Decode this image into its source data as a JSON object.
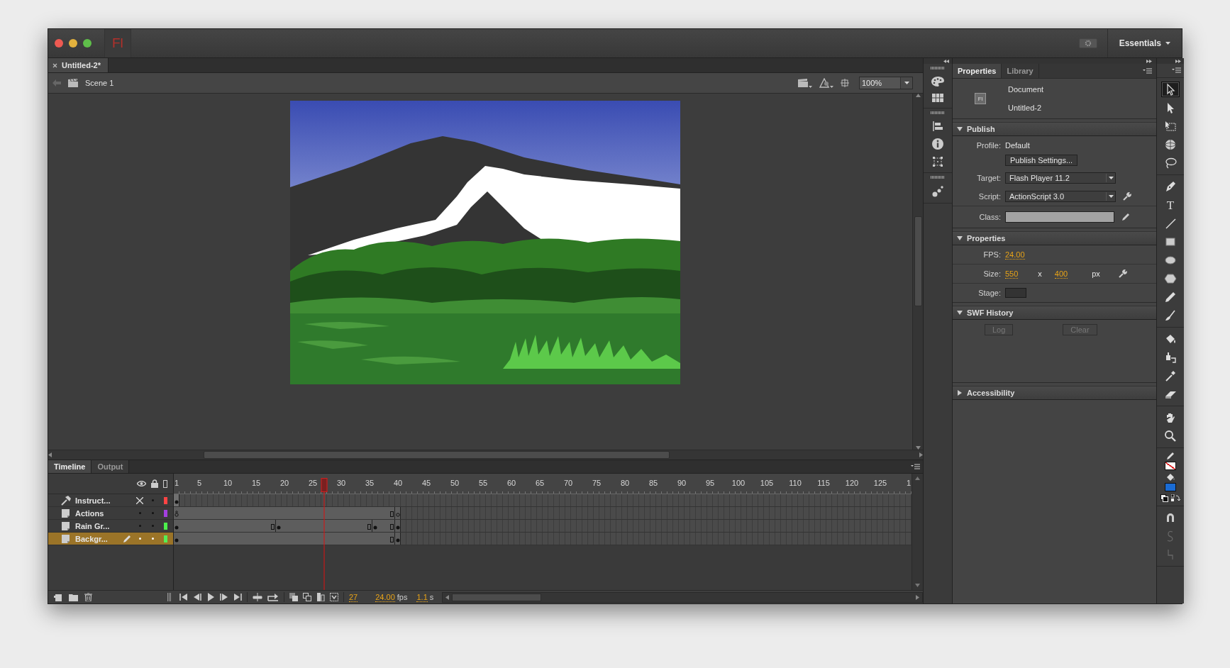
{
  "window": {
    "app_logo": "Fl",
    "workspace": "Essentials"
  },
  "document_tabs": [
    {
      "label": "Untitled-2*",
      "selected": true
    }
  ],
  "scene_bar": {
    "scene": "Scene 1",
    "zoom": "100%"
  },
  "properties_panel": {
    "tabs": [
      {
        "label": "Properties",
        "selected": true
      },
      {
        "label": "Library",
        "selected": false
      }
    ],
    "document": {
      "icon_text": "Fl",
      "type": "Document",
      "name": "Untitled-2"
    },
    "sections": [
      {
        "kind": "publish",
        "title": "Publish",
        "expanded": true,
        "profile_label": "Profile:",
        "profile_value": "Default",
        "settings_button": "Publish Settings...",
        "target_label": "Target:",
        "target_value": "Flash Player 11.2",
        "script_label": "Script:",
        "script_value": "ActionScript 3.0",
        "class_label": "Class:"
      },
      {
        "kind": "properties",
        "title": "Properties",
        "expanded": true,
        "fps_label": "FPS:",
        "fps_value": "24.00",
        "size_label": "Size:",
        "width_value": "550",
        "times": "x",
        "height_value": "400",
        "unit": "px",
        "stage_label": "Stage:"
      },
      {
        "kind": "swf_history",
        "title": "SWF History",
        "expanded": true,
        "buttons": [
          {
            "label": "Log",
            "disabled": true
          },
          {
            "label": "Clear",
            "disabled": true
          }
        ]
      },
      {
        "kind": "accessibility",
        "title": "Accessibility",
        "expanded": false
      }
    ]
  },
  "tools": {
    "groups": [
      [
        {
          "kind": "selection",
          "selected": true
        },
        {
          "kind": "subselection",
          "selected": false
        },
        {
          "kind": "free_transform",
          "selected": false
        },
        {
          "kind": "rotation_3d",
          "selected": false
        },
        {
          "kind": "lasso",
          "selected": false
        }
      ],
      [
        {
          "kind": "pen",
          "selected": false
        },
        {
          "kind": "text",
          "glyph": "T",
          "selected": false
        },
        {
          "kind": "line",
          "selected": false
        },
        {
          "kind": "rectangle",
          "selected": false
        },
        {
          "kind": "oval",
          "selected": false
        },
        {
          "kind": "polystar",
          "selected": false
        },
        {
          "kind": "pencil",
          "selected": false
        },
        {
          "kind": "brush",
          "selected": false
        }
      ],
      [
        {
          "kind": "paint_bucket",
          "selected": false
        },
        {
          "kind": "ink_bottle",
          "selected": false
        },
        {
          "kind": "eyedropper",
          "selected": false
        },
        {
          "kind": "eraser",
          "selected": false
        }
      ],
      [
        {
          "kind": "hand",
          "selected": false
        },
        {
          "kind": "zoom",
          "selected": false
        }
      ],
      [
        {
          "kind": "stroke_swatch",
          "color": "#ffffff",
          "none": true
        },
        {
          "kind": "fill_swatch",
          "color": "#1a6bd3",
          "none": false
        },
        {
          "kind": "color_buttons"
        }
      ],
      [
        {
          "kind": "snap",
          "selected": false
        },
        {
          "kind": "smooth",
          "selected": false
        },
        {
          "kind": "straighten",
          "selected": false
        }
      ]
    ]
  },
  "timeline": {
    "tabs": [
      {
        "label": "Timeline",
        "selected": true
      },
      {
        "label": "Output",
        "selected": false
      }
    ],
    "ruler": [
      "1",
      "5",
      "10",
      "15",
      "20",
      "25",
      "30",
      "35",
      "40",
      "45",
      "50",
      "55",
      "60",
      "65",
      "70",
      "75",
      "80",
      "85",
      "90",
      "95",
      "100",
      "105",
      "110",
      "115",
      "120",
      "125",
      "1"
    ],
    "playhead": {
      "level": 0.2038
    },
    "layers": [
      {
        "name": "Instruct...",
        "kind": "guide",
        "hidden": true,
        "locked": false,
        "selected": false,
        "color": "#ff4444",
        "frames": [
          {
            "kind": "keyframe"
          }
        ]
      },
      {
        "name": "Actions",
        "kind": "normal",
        "hidden": false,
        "locked": false,
        "selected": false,
        "color": "#a33fe0",
        "frames": [
          {
            "kind": "action_keyframe"
          },
          {
            "kind": "frame"
          },
          {
            "kind": "frame"
          },
          {
            "kind": "frame"
          },
          {
            "kind": "frame"
          },
          {
            "kind": "frame"
          },
          {
            "kind": "frame"
          },
          {
            "kind": "frame"
          },
          {
            "kind": "frame"
          },
          {
            "kind": "frame"
          },
          {
            "kind": "frame"
          },
          {
            "kind": "frame"
          },
          {
            "kind": "frame"
          },
          {
            "kind": "frame"
          },
          {
            "kind": "frame"
          },
          {
            "kind": "frame"
          },
          {
            "kind": "frame"
          },
          {
            "kind": "frame"
          },
          {
            "kind": "frame"
          },
          {
            "kind": "frame"
          },
          {
            "kind": "frame"
          },
          {
            "kind": "frame"
          },
          {
            "kind": "frame"
          },
          {
            "kind": "frame"
          },
          {
            "kind": "frame"
          },
          {
            "kind": "frame"
          },
          {
            "kind": "frame"
          },
          {
            "kind": "frame"
          },
          {
            "kind": "frame"
          },
          {
            "kind": "frame"
          },
          {
            "kind": "frame"
          },
          {
            "kind": "frame"
          },
          {
            "kind": "frame"
          },
          {
            "kind": "frame"
          },
          {
            "kind": "frame"
          },
          {
            "kind": "frame"
          },
          {
            "kind": "frame"
          },
          {
            "kind": "frame"
          },
          {
            "kind": "end_frame"
          },
          {
            "kind": "empty_keyframe"
          }
        ]
      },
      {
        "name": "Rain Gr...",
        "kind": "normal",
        "hidden": false,
        "locked": false,
        "selected": false,
        "color": "#4cf04c",
        "frames": [
          {
            "kind": "keyframe"
          },
          {
            "kind": "frame"
          },
          {
            "kind": "frame"
          },
          {
            "kind": "frame"
          },
          {
            "kind": "frame"
          },
          {
            "kind": "frame"
          },
          {
            "kind": "frame"
          },
          {
            "kind": "frame"
          },
          {
            "kind": "frame"
          },
          {
            "kind": "frame"
          },
          {
            "kind": "frame"
          },
          {
            "kind": "frame"
          },
          {
            "kind": "frame"
          },
          {
            "kind": "frame"
          },
          {
            "kind": "frame"
          },
          {
            "kind": "frame"
          },
          {
            "kind": "frame"
          },
          {
            "kind": "end_frame"
          },
          {
            "kind": "keyframe"
          },
          {
            "kind": "frame"
          },
          {
            "kind": "frame"
          },
          {
            "kind": "frame"
          },
          {
            "kind": "frame"
          },
          {
            "kind": "frame"
          },
          {
            "kind": "frame"
          },
          {
            "kind": "frame"
          },
          {
            "kind": "frame"
          },
          {
            "kind": "frame"
          },
          {
            "kind": "frame"
          },
          {
            "kind": "frame"
          },
          {
            "kind": "frame"
          },
          {
            "kind": "frame"
          },
          {
            "kind": "frame"
          },
          {
            "kind": "frame"
          },
          {
            "kind": "end_frame"
          },
          {
            "kind": "keyframe"
          },
          {
            "kind": "frame"
          },
          {
            "kind": "frame"
          },
          {
            "kind": "end_frame"
          },
          {
            "kind": "keyframe"
          }
        ]
      },
      {
        "name": "Backgr...",
        "kind": "normal",
        "hidden": false,
        "locked": false,
        "selected": true,
        "color": "#55ee55",
        "frames": [
          {
            "kind": "keyframe"
          },
          {
            "kind": "frame"
          },
          {
            "kind": "frame"
          },
          {
            "kind": "frame"
          },
          {
            "kind": "frame"
          },
          {
            "kind": "frame"
          },
          {
            "kind": "frame"
          },
          {
            "kind": "frame"
          },
          {
            "kind": "frame"
          },
          {
            "kind": "frame"
          },
          {
            "kind": "frame"
          },
          {
            "kind": "frame"
          },
          {
            "kind": "frame"
          },
          {
            "kind": "frame"
          },
          {
            "kind": "frame"
          },
          {
            "kind": "frame"
          },
          {
            "kind": "frame"
          },
          {
            "kind": "frame"
          },
          {
            "kind": "frame"
          },
          {
            "kind": "frame"
          },
          {
            "kind": "frame"
          },
          {
            "kind": "frame"
          },
          {
            "kind": "frame"
          },
          {
            "kind": "frame"
          },
          {
            "kind": "frame"
          },
          {
            "kind": "frame"
          },
          {
            "kind": "frame"
          },
          {
            "kind": "frame"
          },
          {
            "kind": "frame"
          },
          {
            "kind": "frame"
          },
          {
            "kind": "frame"
          },
          {
            "kind": "frame"
          },
          {
            "kind": "frame"
          },
          {
            "kind": "frame"
          },
          {
            "kind": "frame"
          },
          {
            "kind": "frame"
          },
          {
            "kind": "frame"
          },
          {
            "kind": "frame"
          },
          {
            "kind": "end_frame"
          },
          {
            "kind": "keyframe"
          }
        ]
      }
    ],
    "controls": {
      "current_frame": "27",
      "fps": "24.00",
      "fps_unit": "fps",
      "time": "1.1",
      "time_unit": "s"
    }
  }
}
